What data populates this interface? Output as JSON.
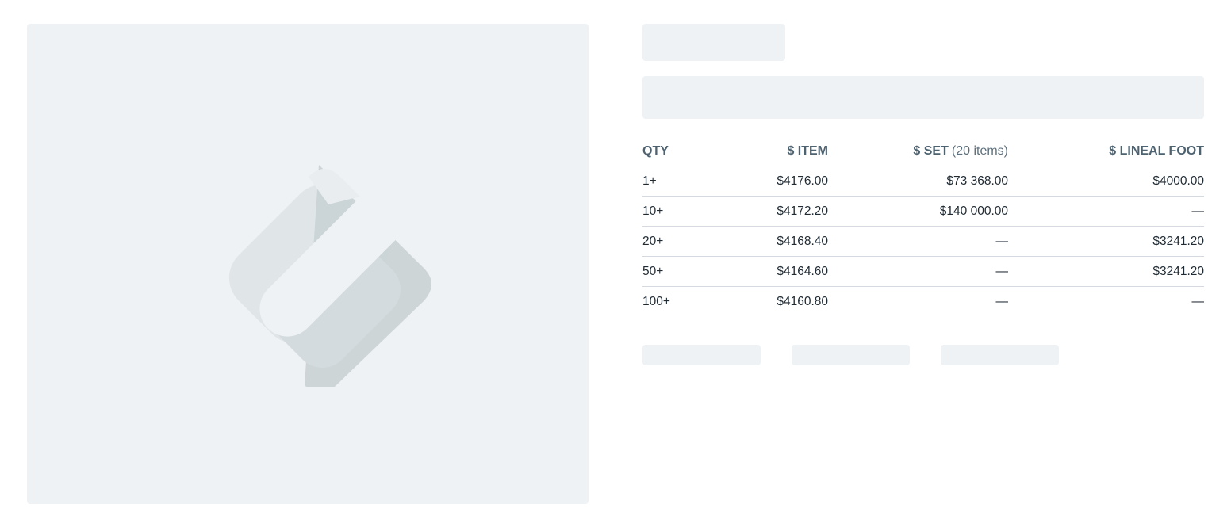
{
  "product_image": {
    "icon": "image-placeholder-icon"
  },
  "price_table": {
    "headers": {
      "qty": "QTY",
      "item": "$ ITEM",
      "set": "$ SET",
      "set_note": "(20 items)",
      "lineal_foot": "$ LINEAL FOOT"
    },
    "rows": [
      {
        "qty": "1+",
        "item": "$4176.00",
        "set": "$73 368.00",
        "lineal_foot": "$4000.00"
      },
      {
        "qty": "10+",
        "item": "$4172.20",
        "set": "$140 000.00",
        "lineal_foot": "—"
      },
      {
        "qty": "20+",
        "item": "$4168.40",
        "set": "—",
        "lineal_foot": "$3241.20"
      },
      {
        "qty": "50+",
        "item": "$4164.60",
        "set": "—",
        "lineal_foot": "$3241.20"
      },
      {
        "qty": "100+",
        "item": "$4160.80",
        "set": "—",
        "lineal_foot": "—"
      }
    ]
  },
  "colors": {
    "skeleton": "#eef2f5",
    "header_text": "#4e6270",
    "row_divider": "#d4dadf",
    "body_text": "#1f2a33"
  }
}
